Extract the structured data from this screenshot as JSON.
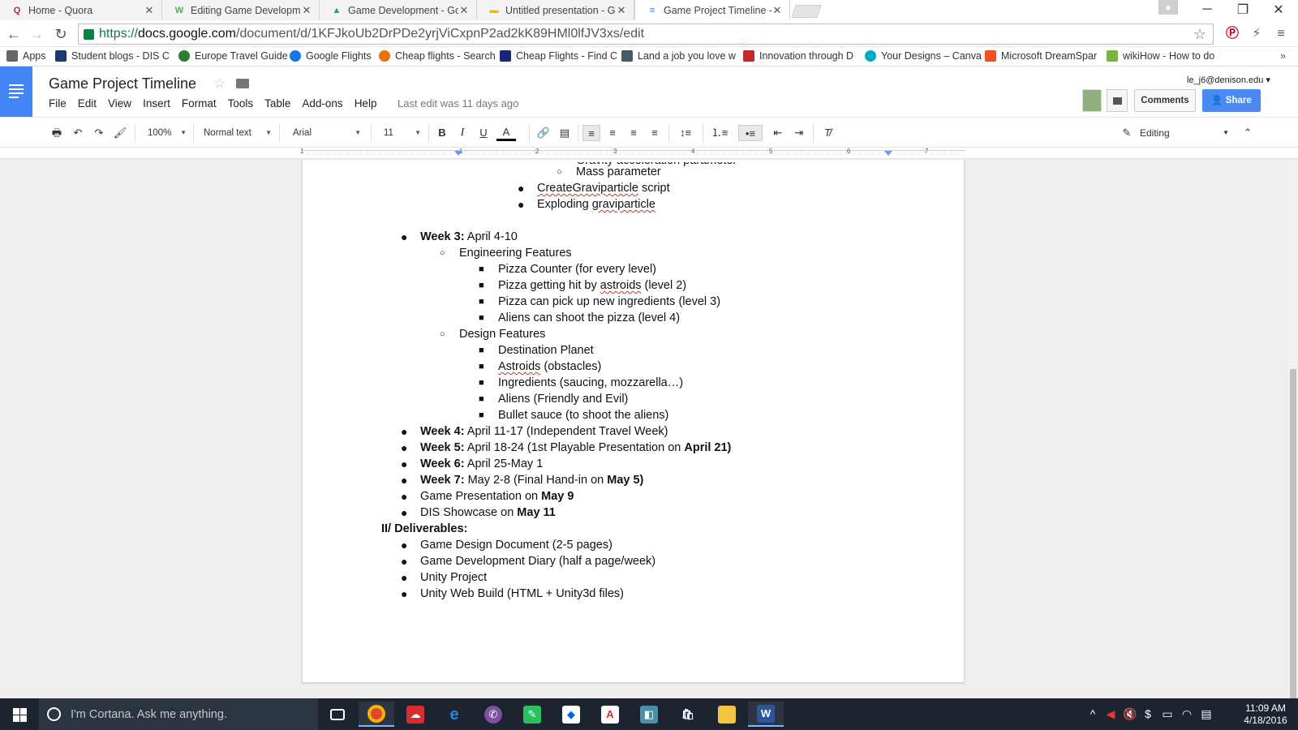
{
  "browser": {
    "tabs": [
      {
        "title": "Home - Quora",
        "favicon": "Q",
        "color": "#b92b27"
      },
      {
        "title": "Editing Game Developme",
        "favicon": "W",
        "color": "#4cae4c"
      },
      {
        "title": "Game Development - Goo",
        "favicon": "▲",
        "color": "#1fa463"
      },
      {
        "title": "Untitled presentation - Go",
        "favicon": "▬",
        "color": "#f4b400"
      },
      {
        "title": "Game Project Timeline - G",
        "favicon": "≡",
        "color": "#4285f4"
      }
    ],
    "url": {
      "scheme": "https://",
      "host": "docs.google.com",
      "path": "/document/d/1KFJkoUb2DrPDe2yrjViCxpnP2ad2kK89HMl0lfJV3xs/edit"
    },
    "bookmarks": [
      {
        "label": "Apps",
        "color": "#666666"
      },
      {
        "label": "Student blogs - DIS C",
        "color": "#1b3b6f"
      },
      {
        "label": "Europe Travel Guide",
        "color": "#2e7d32"
      },
      {
        "label": "Google Flights",
        "color": "#1a73e8"
      },
      {
        "label": "Cheap flights - Search",
        "color": "#e8710a"
      },
      {
        "label": "Cheap Flights - Find C",
        "color": "#1a237e"
      },
      {
        "label": "Land a job you love w",
        "color": "#455a64"
      },
      {
        "label": "Innovation through D",
        "color": "#c62828"
      },
      {
        "label": "Your Designs – Canva",
        "color": "#00acc1"
      },
      {
        "label": "Microsoft DreamSpar",
        "color": "#f25022"
      },
      {
        "label": "wikiHow - How to do",
        "color": "#7cb342"
      }
    ]
  },
  "docs": {
    "title": "Game Project Timeline",
    "menu": [
      "File",
      "Edit",
      "View",
      "Insert",
      "Format",
      "Tools",
      "Table",
      "Add-ons",
      "Help"
    ],
    "last_edit": "Last edit was 11 days ago",
    "user_email": "le_j6@denison.edu",
    "comments_label": "Comments",
    "share_label": "Share",
    "toolbar": {
      "zoom": "100%",
      "style": "Normal text",
      "font": "Arial",
      "size": "11",
      "mode": "Editing"
    },
    "ruler": [
      "1",
      "1",
      "2",
      "3",
      "4",
      "5",
      "6",
      "7"
    ]
  },
  "document": {
    "partial_top": "Gravity acceleration parameter",
    "lines": {
      "l1": "Mass parameter",
      "l2a": "CreateGraviparticle",
      "l2b": " script",
      "l3a": "Exploding ",
      "l3b": "graviparticle",
      "w3a": "Week 3:",
      "w3b": " April 4-10",
      "eng": "Engineering Features",
      "e1": "Pizza Counter (for every level)",
      "e2a": "Pizza getting hit by ",
      "e2b": "astroids",
      "e2c": " (level 2)",
      "e3": "Pizza can pick up new ingredients (level 3)",
      "e4": "Aliens can shoot the pizza (level 4)",
      "des": "Design Features",
      "d1": "Destination Planet",
      "d2a": "Astroids",
      "d2b": " (obstacles)",
      "d3": "Ingredients (saucing, mozzarella…)",
      "d4": "Aliens (Friendly and Evil)",
      "d5": "Bullet sauce (to shoot the aliens)",
      "w4a": "Week 4:",
      "w4b": " April 11-17 (Independent Travel Week)",
      "w5a": "Week 5:",
      "w5b": " April 18-24 (1st Playable Presentation on ",
      "w5c": "April 21)",
      "w6a": "Week 6:",
      "w6b": " April 25-May 1",
      "w7a": "Week 7:",
      "w7b": " May 2-8 (Final Hand-in on ",
      "w7c": "May 5)",
      "gp_a": "Game Presentation on ",
      "gp_b": "May 9",
      "ds_a": "DIS Showcase on ",
      "ds_b": "May 11",
      "deliv": "II/ Deliverables:",
      "dv1": "Game Design Document (2-5 pages)",
      "dv2": "Game Development Diary (half a page/week)",
      "dv3": "Unity Project",
      "dv4": "Unity Web Build (HTML + Unity3d files)"
    }
  },
  "taskbar": {
    "cortana_placeholder": "I'm Cortana. Ask me anything.",
    "time": "11:09 AM",
    "date": "4/18/2016"
  }
}
